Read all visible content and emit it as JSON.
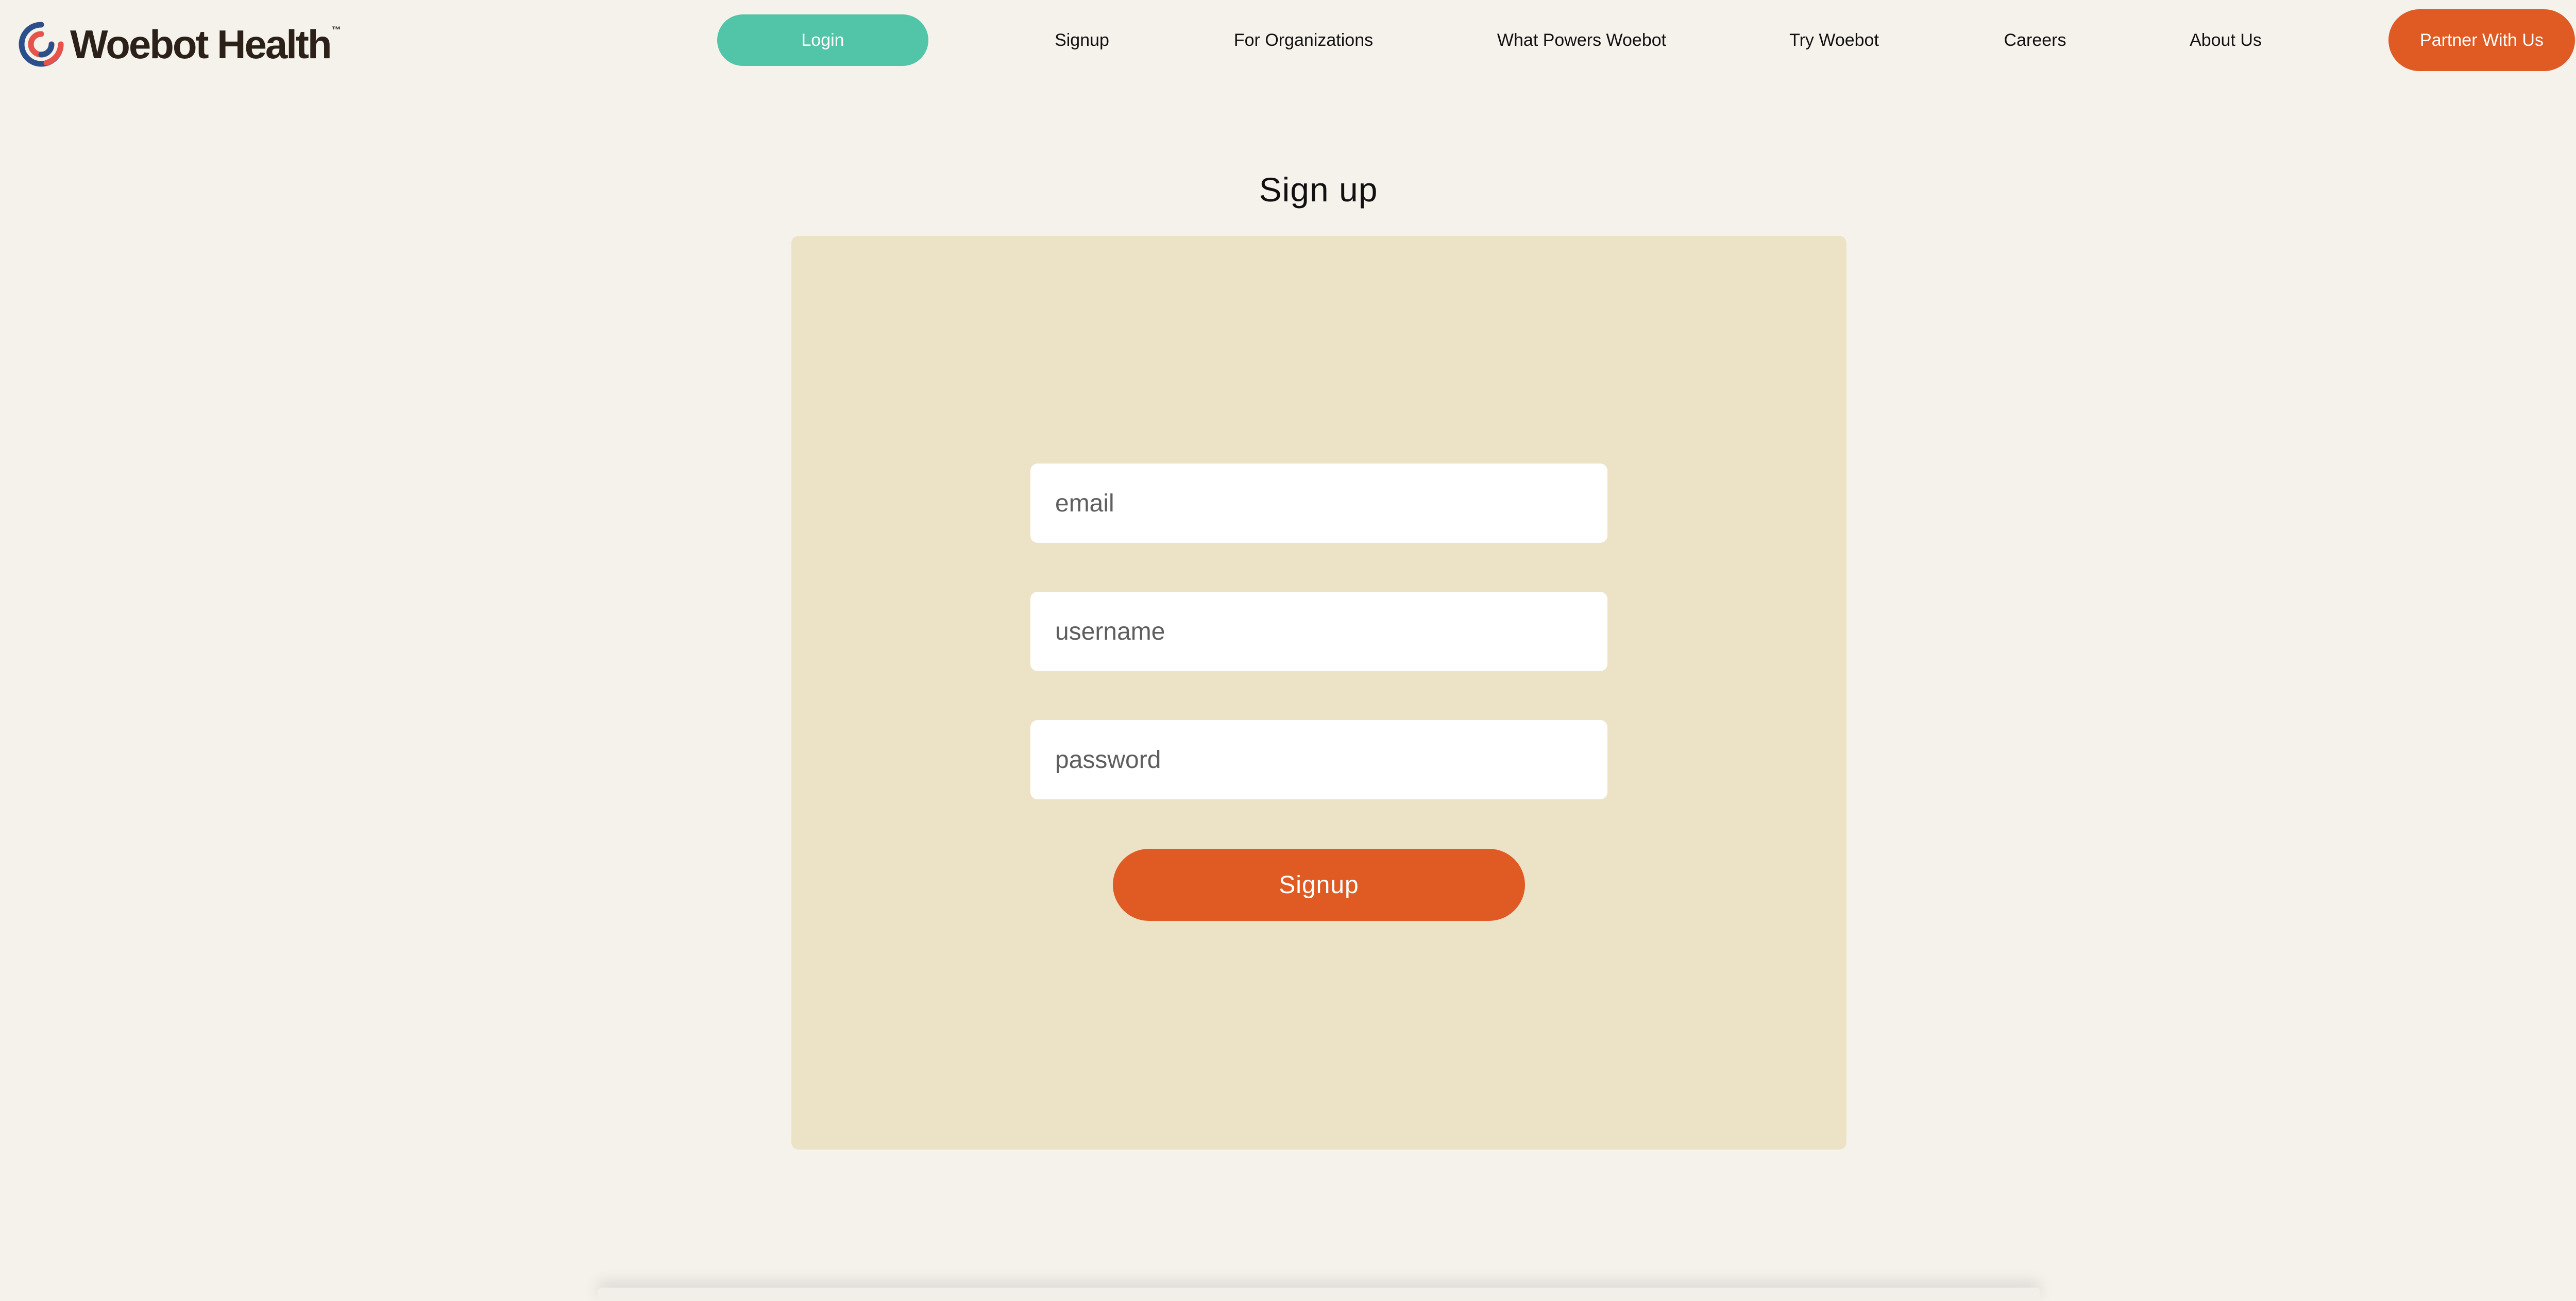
{
  "brand": {
    "name": "Woebot Health",
    "trademark": "™",
    "logo_icon": "woebot-swirl-icon",
    "colors": {
      "navy": "#2b4f8a",
      "coral": "#e5534b",
      "text": "#2b2118"
    }
  },
  "nav": {
    "login": "Login",
    "signup": "Signup",
    "for_organizations": "For Organizations",
    "what_powers": "What Powers Woebot",
    "try_woebot": "Try Woebot",
    "careers": "Careers",
    "about_us": "About Us",
    "partner": "Partner With Us"
  },
  "signup_form": {
    "title": "Sign up",
    "email_placeholder": "email",
    "username_placeholder": "username",
    "password_placeholder": "password",
    "submit_label": "Signup"
  },
  "colors": {
    "page_background": "#f5f2ec",
    "card_background": "#ece3c6",
    "accent_teal": "#52c5a8",
    "accent_orange": "#e05a24"
  }
}
